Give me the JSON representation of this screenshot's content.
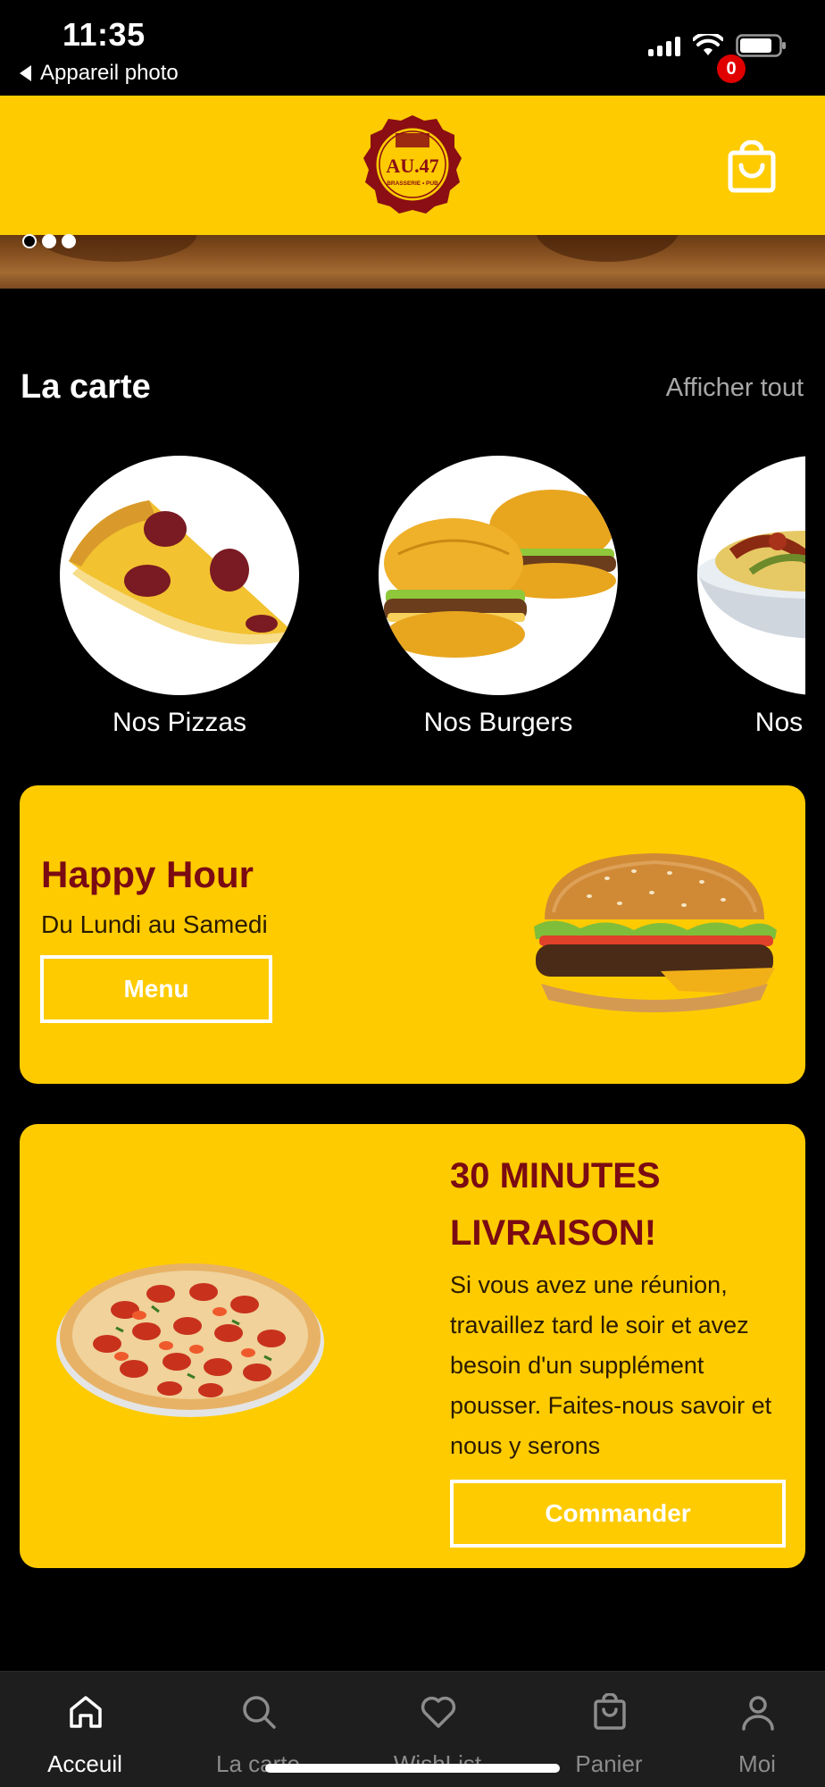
{
  "status_bar": {
    "time": "11:35",
    "back_label": "Appareil photo"
  },
  "header": {
    "logo_text": "AU.47",
    "logo_subtext": "BRASSERIE • PUB",
    "cart_count": "0"
  },
  "banner": {
    "slide_count": 3,
    "active_slide": 1
  },
  "menu_section": {
    "title": "La carte",
    "view_all": "Afficher tout",
    "categories": [
      {
        "label": "Nos Pizzas",
        "icon": "pizza-slice-icon"
      },
      {
        "label": "Nos Burgers",
        "icon": "burgers-icon"
      },
      {
        "label": "Nos Pâtes",
        "icon": "pasta-bowl-icon"
      }
    ]
  },
  "happy_hour": {
    "title": "Happy Hour",
    "subtitle": "Du Lundi au Samedi",
    "button": "Menu"
  },
  "delivery": {
    "title": "30 MINUTES LIVRAISON!",
    "text": "Si vous avez une réunion, travaillez tard le soir et avez besoin d'un supplément pousser. Faites-nous savoir et nous y serons",
    "button": "Commander"
  },
  "tabs": [
    {
      "label": "Acceuil",
      "icon": "home-icon",
      "active": true
    },
    {
      "label": "La carte",
      "icon": "search-icon",
      "active": false
    },
    {
      "label": "WishList",
      "icon": "heart-icon",
      "active": false
    },
    {
      "label": "Panier",
      "icon": "bag-icon",
      "active": false
    },
    {
      "label": "Moi",
      "icon": "user-icon",
      "active": false
    }
  ],
  "colors": {
    "brand_yellow": "#fecb00",
    "title_red": "#7a0b12",
    "badge_red": "#e00000",
    "background": "#000000"
  }
}
